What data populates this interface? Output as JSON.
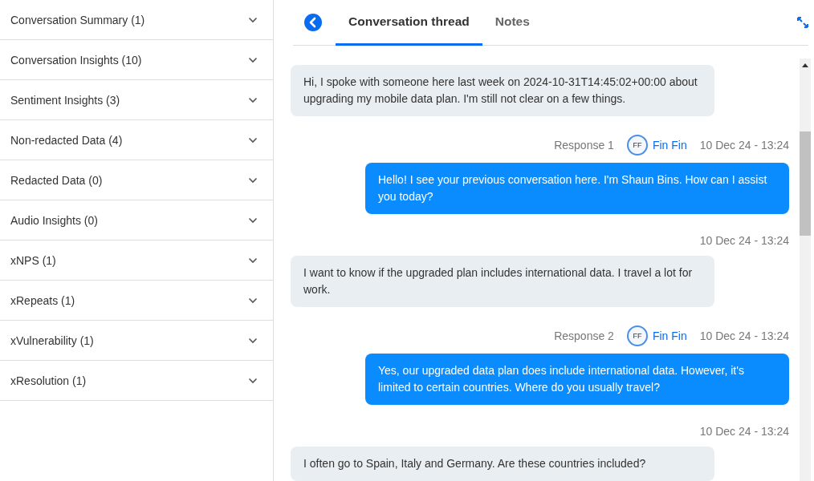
{
  "sidebar": {
    "sections": [
      {
        "label": "Conversation Summary (1)",
        "expanded": false
      },
      {
        "label": "Conversation Insights (10)",
        "expanded": false
      },
      {
        "label": "Sentiment Insights (3)",
        "expanded": false
      },
      {
        "label": "Non-redacted Data (4)",
        "expanded": false
      },
      {
        "label": "Redacted Data (0)",
        "expanded": false
      },
      {
        "label": "Audio Insights (0)",
        "expanded": false
      },
      {
        "label": "xNPS (1)",
        "expanded": false
      },
      {
        "label": "xRepeats (1)",
        "expanded": false
      },
      {
        "label": "xVulnerability (1)",
        "expanded": false
      },
      {
        "label": "xResolution (1)",
        "expanded": false
      }
    ]
  },
  "tabs": [
    {
      "label": "Conversation thread",
      "selected": true
    },
    {
      "label": "Notes",
      "selected": false
    }
  ],
  "messages": [
    {
      "kind": "customer",
      "text": "Hi, I spoke with someone here last week on 2024-10-31T14:45:02+00:00 about upgrading my mobile data plan. I'm still not clear on a few things."
    },
    {
      "kind": "agent",
      "response": "Response 1",
      "initials": "FF",
      "agent": "Fin Fin",
      "time": "10 Dec 24 - 13:24",
      "text": "Hello! I see your previous conversation here. I'm Shaun Bins. How can I assist you today?"
    },
    {
      "kind": "customer",
      "time": "10 Dec 24 - 13:24",
      "text": "I want to know if the upgraded plan includes international data. I travel a lot for work."
    },
    {
      "kind": "agent",
      "response": "Response 2",
      "initials": "FF",
      "agent": "Fin Fin",
      "time": "10 Dec 24 - 13:24",
      "text": "Yes, our upgraded data plan does include international data. However, it's limited to certain countries. Where do you usually travel?"
    },
    {
      "kind": "customer",
      "time": "10 Dec 24 - 13:24",
      "text": "I often go to Spain, Italy and Germany. Are these countries included?"
    }
  ]
}
